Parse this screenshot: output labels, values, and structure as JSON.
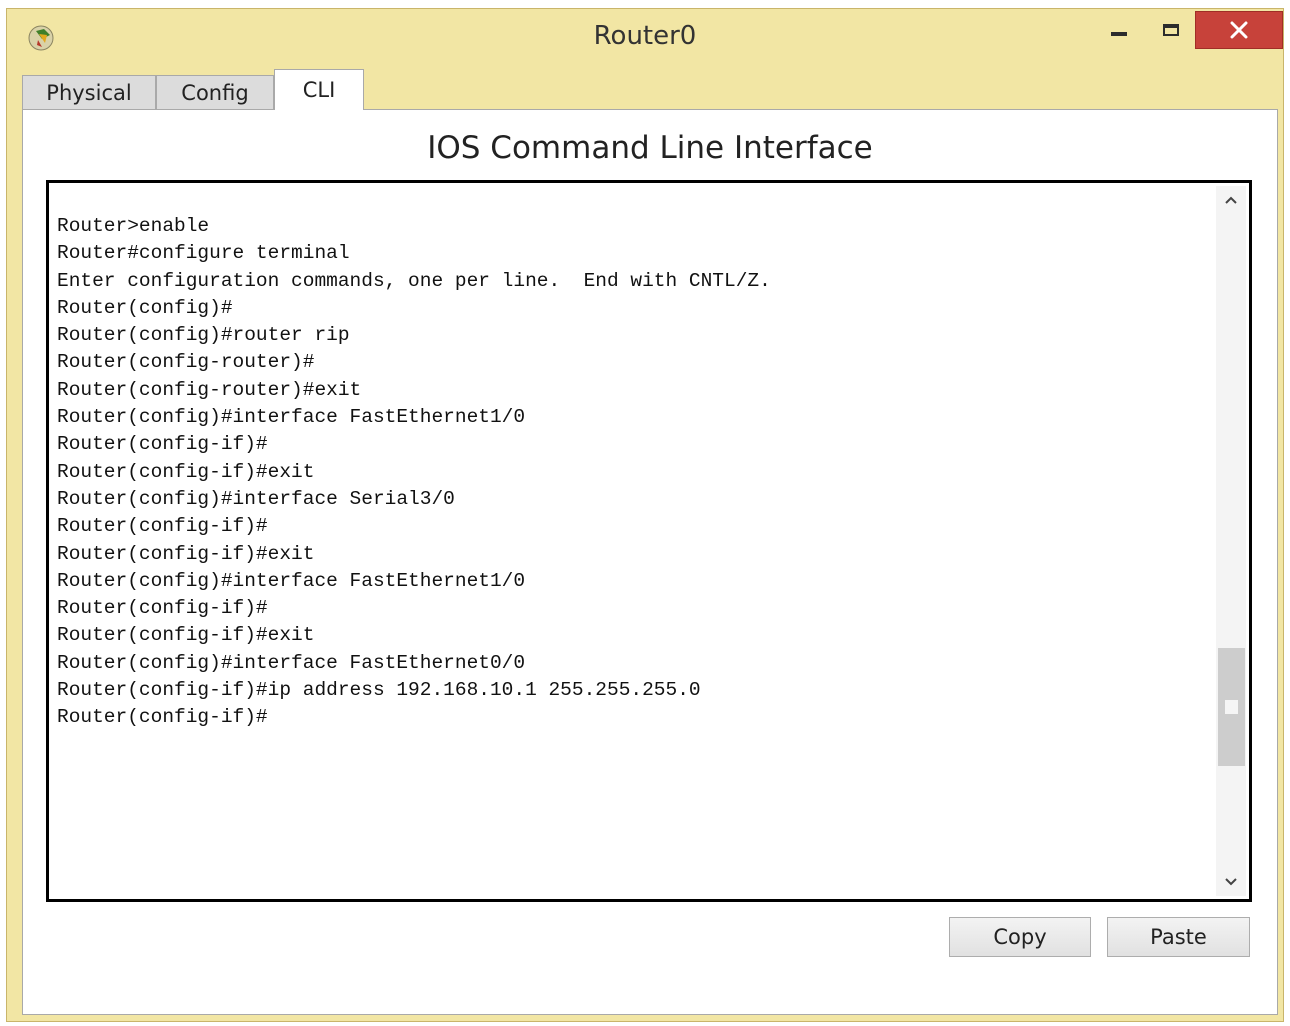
{
  "window": {
    "title": "Router0"
  },
  "tabs": [
    {
      "label": "Physical",
      "active": false
    },
    {
      "label": "Config",
      "active": false
    },
    {
      "label": "CLI",
      "active": true
    }
  ],
  "cli": {
    "heading": "IOS Command Line Interface",
    "lines": [
      "Router>enable",
      "Router#configure terminal",
      "Enter configuration commands, one per line.  End with CNTL/Z.",
      "Router(config)#",
      "Router(config)#router rip",
      "Router(config-router)#",
      "Router(config-router)#exit",
      "Router(config)#interface FastEthernet1/0",
      "Router(config-if)#",
      "Router(config-if)#exit",
      "Router(config)#interface Serial3/0",
      "Router(config-if)#",
      "Router(config-if)#exit",
      "Router(config)#interface FastEthernet1/0",
      "Router(config-if)#",
      "Router(config-if)#exit",
      "Router(config)#interface FastEthernet0/0",
      "Router(config-if)#ip address 192.168.10.1 255.255.255.0",
      "Router(config-if)#"
    ]
  },
  "buttons": {
    "copy": "Copy",
    "paste": "Paste"
  },
  "colors": {
    "close_button": "#c7423a",
    "window_frame": "#f2e6a4"
  }
}
